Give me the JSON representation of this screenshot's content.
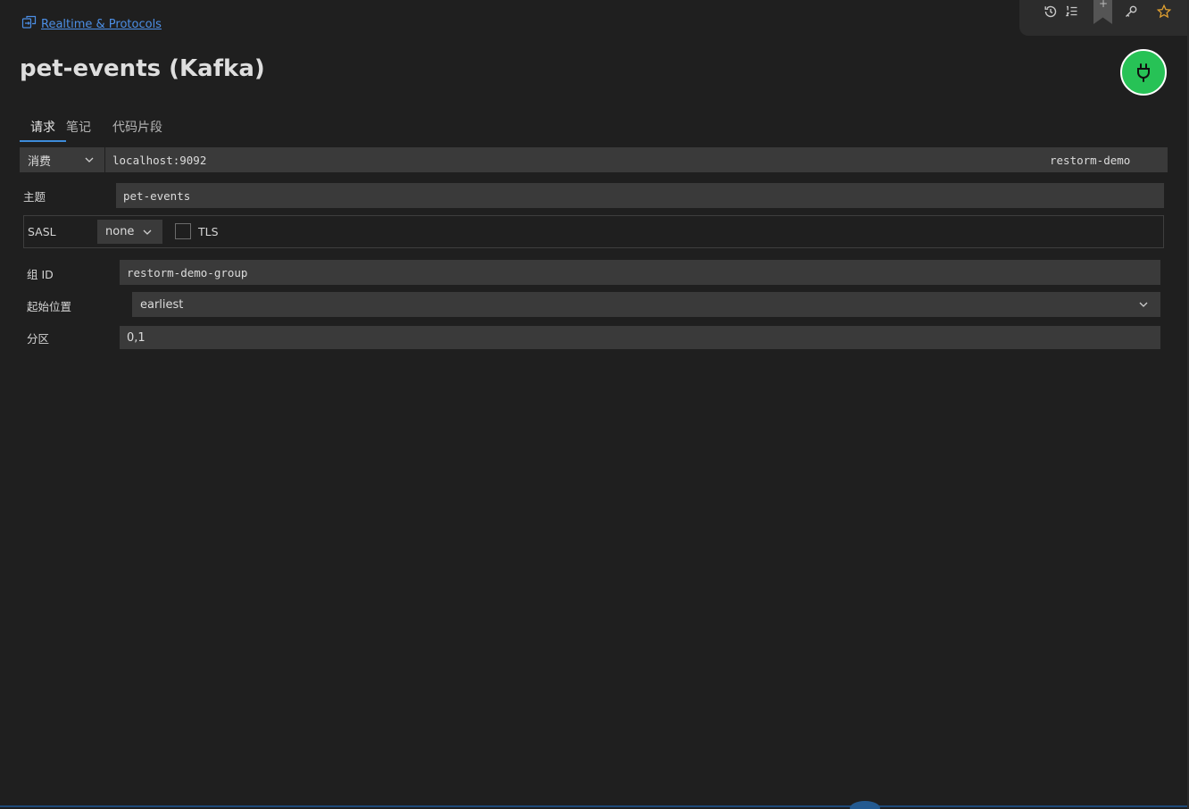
{
  "breadcrumb": {
    "label": "Realtime & Protocols"
  },
  "page": {
    "title": "pet-events (Kafka)"
  },
  "tabs": [
    {
      "label": "请求",
      "active": true
    },
    {
      "label": "笔记",
      "active": false
    },
    {
      "label": "代码片段",
      "active": false
    }
  ],
  "request": {
    "mode": "消费",
    "url": "localhost:9092",
    "environment": "restorm-demo"
  },
  "form": {
    "topic_label": "主题",
    "topic_value": "pet-events",
    "sasl_label": "SASL",
    "sasl_value": "none",
    "tls_label": "TLS",
    "tls_checked": false,
    "group_label": "组 ID",
    "group_value": "restorm-demo-group",
    "start_label": "起始位置",
    "start_value": "earliest",
    "partition_label": "分区",
    "partition_value": "0,1"
  },
  "colors": {
    "background": "#1f1f1f",
    "accent": "#3d8bd9",
    "link": "#4c8fe6",
    "connect": "#27c256",
    "star": "#e0a030"
  },
  "icons": {
    "breadcrumb": "folder-swap-icon",
    "history": "history-icon",
    "list": "numbered-list-icon",
    "bookmark": "bookmark-icon",
    "key": "key-icon",
    "star": "star-icon",
    "connect": "plug-icon"
  }
}
